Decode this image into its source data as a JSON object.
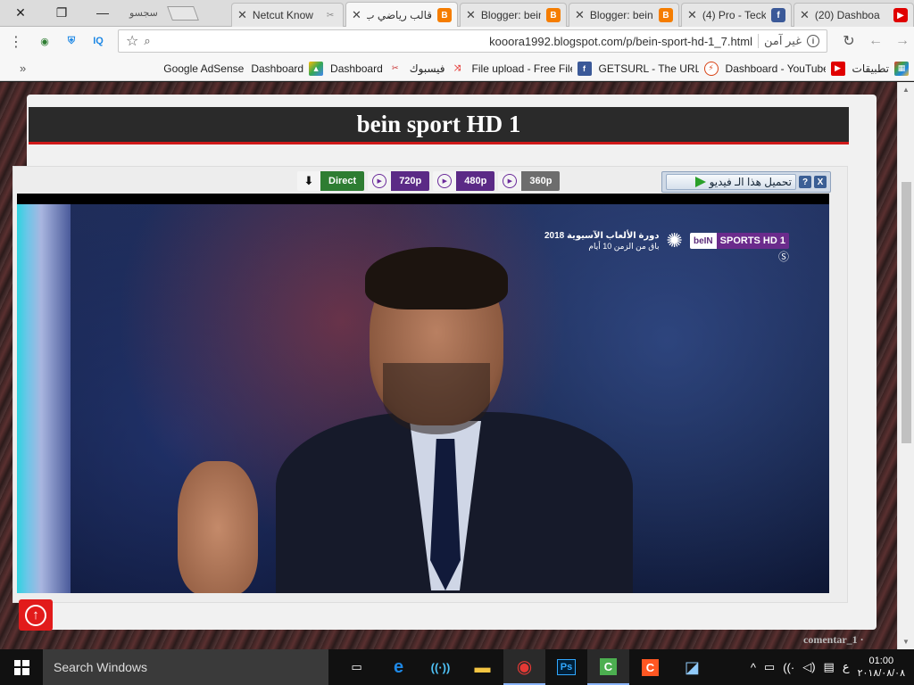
{
  "browser": {
    "tabs": [
      {
        "title": "(20) Dashboa",
        "favicon": "youtube-icon",
        "color": "#e00000"
      },
      {
        "title": "(4) Pro - Teck",
        "favicon": "facebook-icon",
        "color": "#3b5998"
      },
      {
        "title": "Blogger: bein",
        "favicon": "blogger-icon",
        "color": "#f57d00"
      },
      {
        "title": "Blogger: bein",
        "favicon": "blogger-icon",
        "color": "#f57d00"
      },
      {
        "title": "قالب رياضي ب",
        "favicon": "blogger-icon",
        "color": "#f57d00"
      },
      {
        "title": "Netcut Know",
        "favicon": "scissors-icon",
        "color": "#888888"
      }
    ],
    "search_tab_label": "سجسو",
    "address": {
      "security_label": "غير آمن",
      "url": "kooora1992.blogspot.com/p/bein-sport-hd-1_7.html"
    },
    "bookmarks": [
      {
        "label": "تطبيقات",
        "icon": "apps-grid-icon",
        "color": "#e53935"
      },
      {
        "label": "Dashboard - YouTube",
        "icon": "youtube-icon",
        "color": "#e00000"
      },
      {
        "label": "GETSURL - The URL sh",
        "icon": "getsurl-icon",
        "color": "#d84315"
      },
      {
        "label": "File upload - Free File",
        "icon": "file-upload-icon",
        "color": "#3b5998"
      },
      {
        "label": "فيسبوك",
        "icon": "facebook-icon",
        "color": "#3b5998"
      },
      {
        "label": "Dashboard",
        "icon": "dashboard-icon",
        "color": "#e53935"
      },
      {
        "label": "Dashboard",
        "icon": "dashboard-icon",
        "color": "#c62828"
      },
      {
        "label": "Google AdSense",
        "icon": "adsense-icon",
        "color": "#fbbc04"
      }
    ],
    "extensions": [
      "globe-icon",
      "adguard-icon",
      "iq-icon"
    ]
  },
  "page": {
    "title": "bein sport HD 1",
    "qualities": [
      {
        "label": "Direct",
        "style": "direct",
        "icon": "download-arrow-icon"
      },
      {
        "label": "720p",
        "style": "purple",
        "icon": "play-circle-icon"
      },
      {
        "label": "480p",
        "style": "purple",
        "icon": "play-circle-icon"
      },
      {
        "label": "360p",
        "style": "gray",
        "icon": "play-circle-icon"
      }
    ],
    "download_bar": {
      "label": "تحميل هذا الـ فيديو",
      "help": "?",
      "close": "X"
    },
    "video": {
      "overlay_event": "دورة الألعاب الآسيوية 2018",
      "overlay_days": "باق من الزمن 10 أيام",
      "channel_brand": "beIN",
      "channel_name": "SPORTS HD 1"
    },
    "comment_label": "comentar_1 ·"
  },
  "taskbar": {
    "search_placeholder": "Search Windows",
    "apps": [
      {
        "name": "task-view-icon",
        "glyph": "▭",
        "color": "#ffffff"
      },
      {
        "name": "edge-icon",
        "glyph": "e",
        "color": "#1e88e5"
      },
      {
        "name": "network-app-icon",
        "glyph": "((·))",
        "color": "#4fc3f7"
      },
      {
        "name": "file-explorer-icon",
        "glyph": "▬",
        "color": "#f4c542"
      },
      {
        "name": "chrome-icon",
        "glyph": "●",
        "color": "#e53935"
      },
      {
        "name": "photoshop-icon",
        "glyph": "Ps",
        "color": "#31a8ff"
      },
      {
        "name": "camtasia-icon",
        "glyph": "C",
        "color": "#4caf50"
      },
      {
        "name": "camtasia-recorder-icon",
        "glyph": "C",
        "color": "#ff5722"
      },
      {
        "name": "notepad-icon",
        "glyph": "◪",
        "color": "#90caf9"
      }
    ],
    "tray_lang": "ع",
    "time": "01:00",
    "date": "٢٠١٨/٠٨/٠٨"
  }
}
